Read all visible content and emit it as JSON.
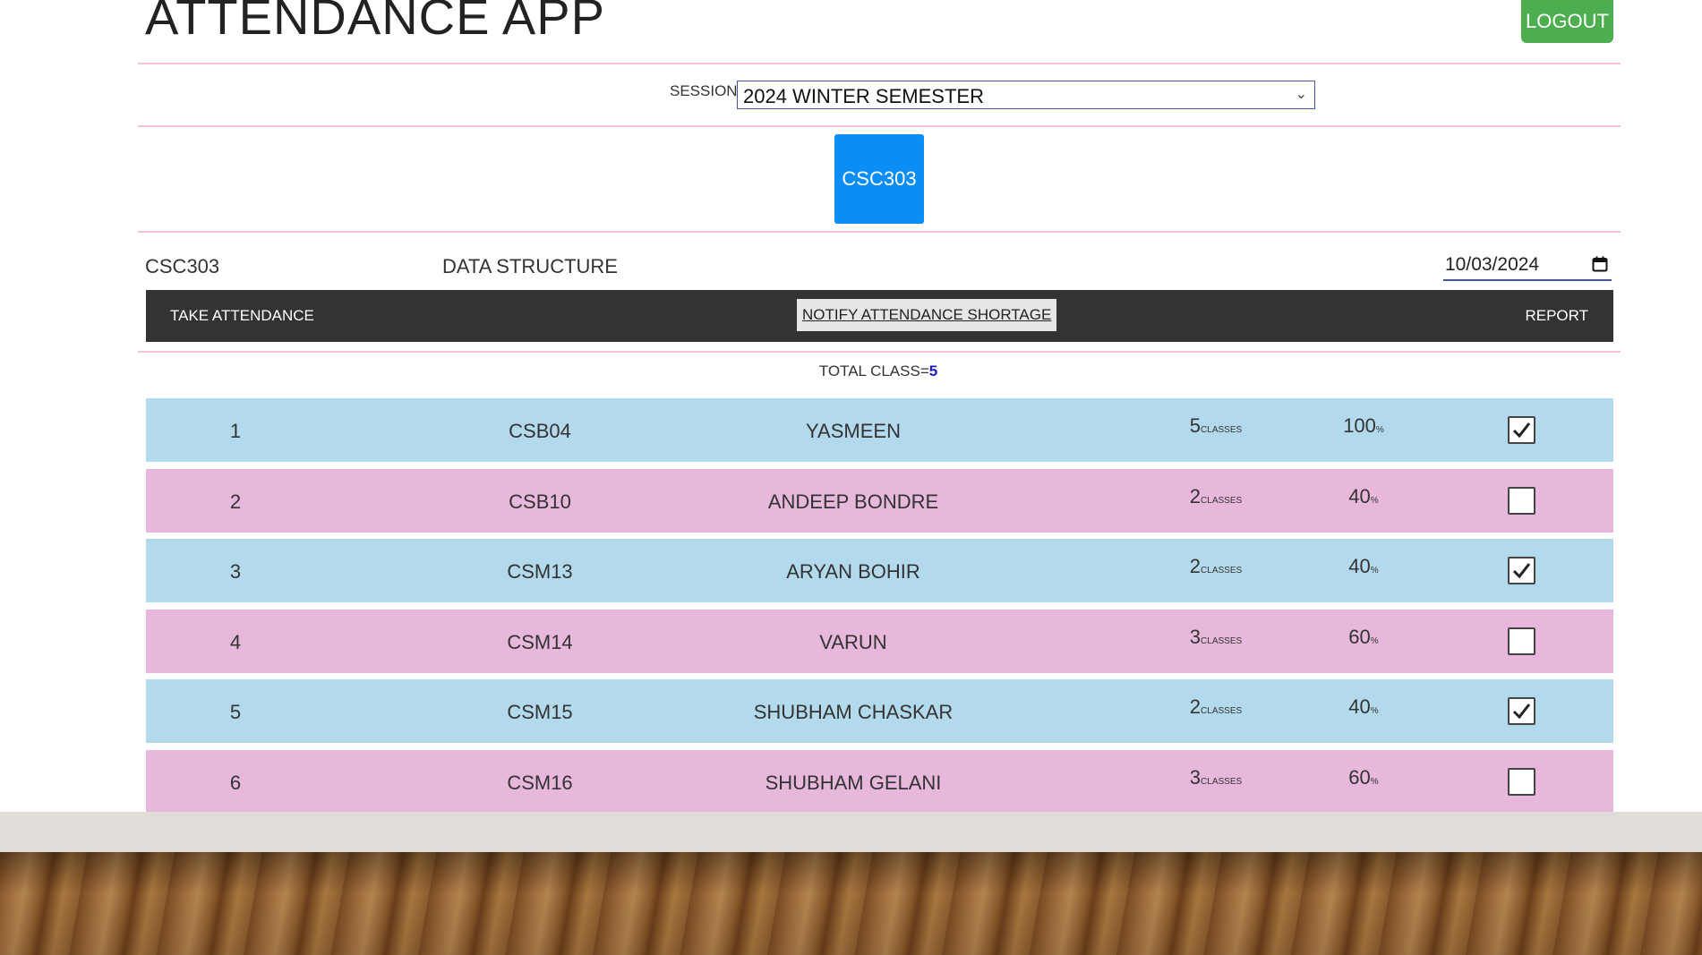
{
  "app": {
    "title": "ATTENDANCE APP",
    "logout_label": "LOGOUT"
  },
  "session": {
    "label": "SESSION",
    "selected": "2024 WINTER SEMESTER"
  },
  "courses": [
    {
      "code": "CSC303"
    }
  ],
  "course_header": {
    "code": "CSC303",
    "name": "DATA STRUCTURE",
    "date": "10/03/2024"
  },
  "toolbar": {
    "take_attendance": "TAKE ATTENDANCE",
    "notify": "NOTIFY ATTENDANCE SHORTAGE",
    "report": "REPORT"
  },
  "total": {
    "label": "TOTAL CLASS=",
    "value": "5"
  },
  "units": {
    "classes": "CLASSES",
    "percent": "%"
  },
  "students": [
    {
      "index": "1",
      "roll": "CSB04",
      "name": "YASMEEN",
      "classes": "5",
      "percent": "100",
      "checked": true,
      "color": "blue"
    },
    {
      "index": "2",
      "roll": "CSB10",
      "name": "ANDEEP BONDRE",
      "classes": "2",
      "percent": "40",
      "checked": false,
      "color": "pink"
    },
    {
      "index": "3",
      "roll": "CSM13",
      "name": "ARYAN BOHIR",
      "classes": "2",
      "percent": "40",
      "checked": true,
      "color": "blue"
    },
    {
      "index": "4",
      "roll": "CSM14",
      "name": "VARUN",
      "classes": "3",
      "percent": "60",
      "checked": false,
      "color": "pink"
    },
    {
      "index": "5",
      "roll": "CSM15",
      "name": "SHUBHAM CHASKAR",
      "classes": "2",
      "percent": "40",
      "checked": true,
      "color": "blue"
    },
    {
      "index": "6",
      "roll": "CSM16",
      "name": "SHUBHAM GELANI",
      "classes": "3",
      "percent": "60",
      "checked": false,
      "color": "pink"
    }
  ],
  "colors": {
    "logout": "#4cae4f",
    "course_tile": "#0a8ef5",
    "toolbar": "#333333",
    "row_blue": "#b3d9ec",
    "row_pink": "#e7b7dc",
    "divider": "#f3c3d3"
  }
}
